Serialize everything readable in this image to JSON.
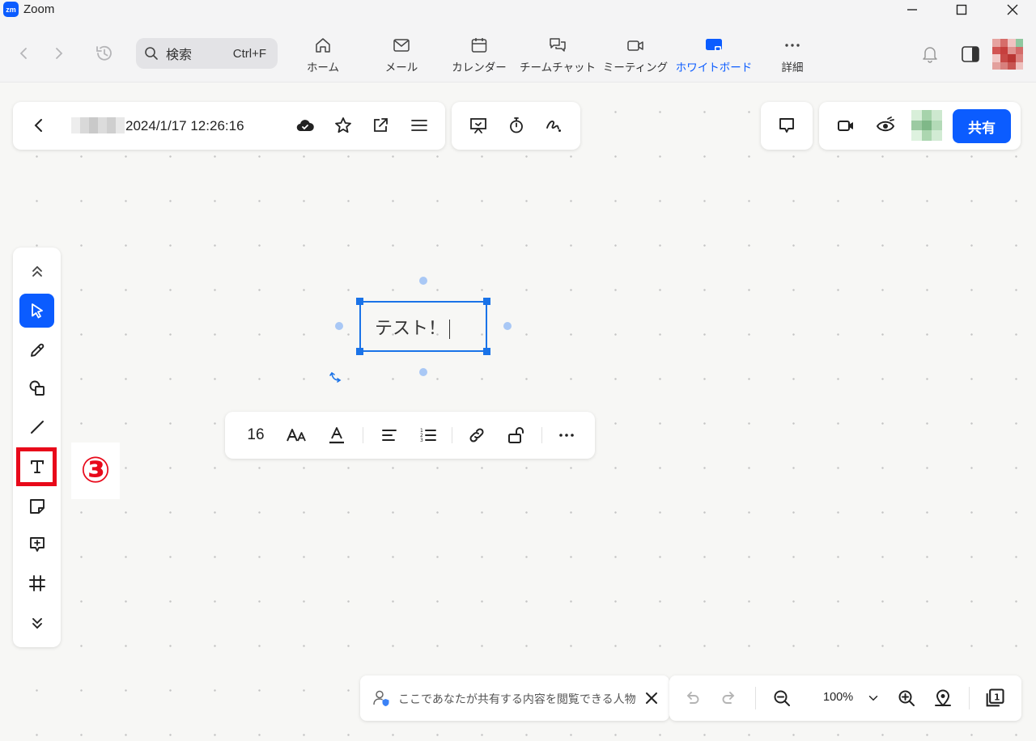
{
  "window": {
    "title": "Zoom",
    "logo_text": "zm"
  },
  "search": {
    "label": "検索",
    "shortcut": "Ctrl+F"
  },
  "nav_tabs": [
    {
      "id": "home",
      "label": "ホーム",
      "icon": "home-icon"
    },
    {
      "id": "mail",
      "label": "メール",
      "icon": "mail-icon"
    },
    {
      "id": "calendar",
      "label": "カレンダー",
      "icon": "calendar-icon"
    },
    {
      "id": "team-chat",
      "label": "チームチャット",
      "icon": "chat-icon"
    },
    {
      "id": "meeting",
      "label": "ミーティング",
      "icon": "video-icon"
    },
    {
      "id": "whiteboard",
      "label": "ホワイトボード",
      "icon": "whiteboard-icon",
      "active": true
    },
    {
      "id": "more",
      "label": "詳細",
      "icon": "more-icon"
    }
  ],
  "board": {
    "title": "2024/1/17 12:26:16",
    "share_label": "共有"
  },
  "textbox": {
    "content": "テスト！"
  },
  "format_bar": {
    "font_size": "16"
  },
  "annotation": {
    "step": "③"
  },
  "notice": {
    "text": "ここであなたが共有する内容を閲覧できる人物"
  },
  "zoom": {
    "level": "100%"
  },
  "colors": {
    "accent": "#0b5cff",
    "selection": "#1a73e8",
    "annotation_red": "#e8091a"
  }
}
